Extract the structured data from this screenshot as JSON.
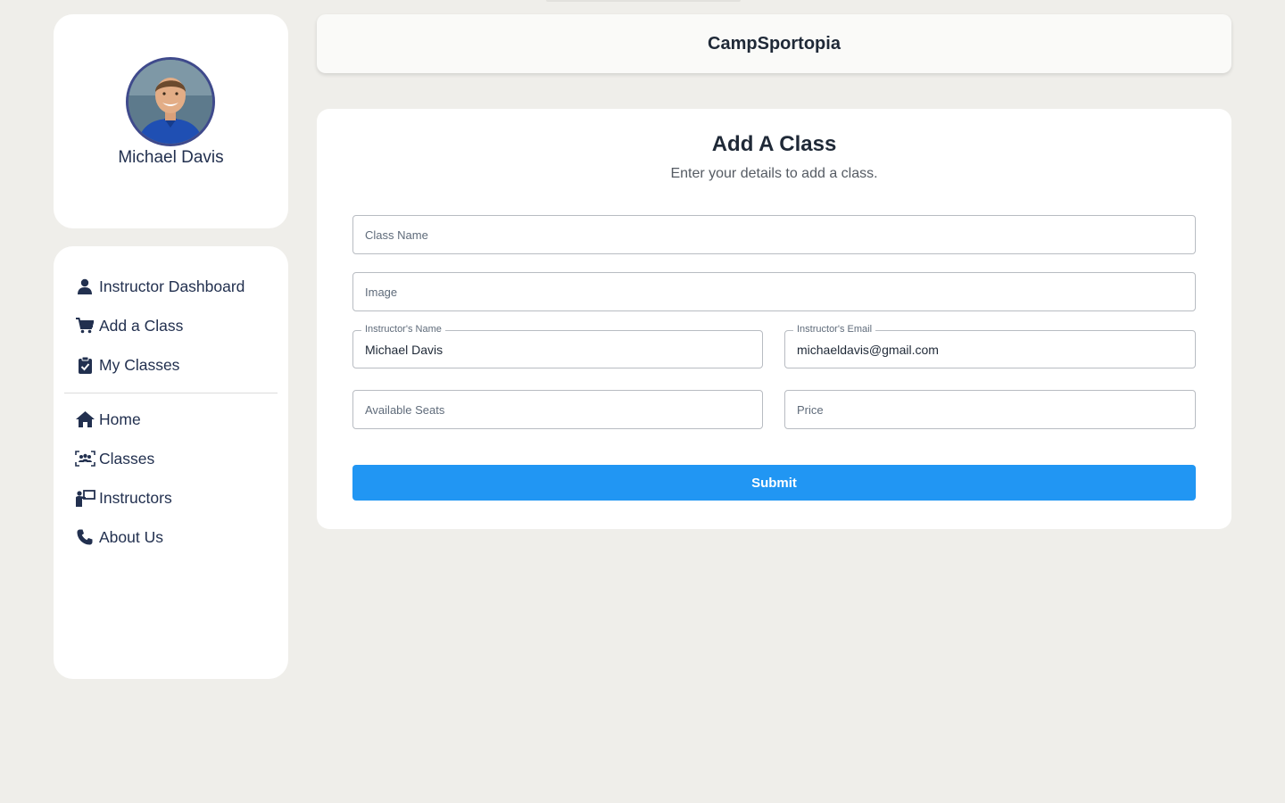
{
  "app": {
    "title": "CampSportopia"
  },
  "profile": {
    "name": "Michael Davis"
  },
  "sidebar": {
    "primary_items": [
      {
        "label": "Instructor Dashboard",
        "icon": "user-icon"
      },
      {
        "label": "Add a Class",
        "icon": "cart-icon"
      },
      {
        "label": "My Classes",
        "icon": "clipboard-check-icon"
      }
    ],
    "secondary_items": [
      {
        "label": "Home",
        "icon": "home-icon"
      },
      {
        "label": "Classes",
        "icon": "group-icon"
      },
      {
        "label": "Instructors",
        "icon": "instructor-icon"
      },
      {
        "label": "About Us",
        "icon": "phone-icon"
      }
    ]
  },
  "form": {
    "title": "Add A Class",
    "subtitle": "Enter your details to add a class.",
    "class_name": {
      "placeholder": "Class Name",
      "value": ""
    },
    "image": {
      "placeholder": "Image",
      "value": ""
    },
    "instructor_name": {
      "label": "Instructor's Name",
      "value": "Michael Davis"
    },
    "instructor_email": {
      "label": "Instructor's Email",
      "value": "michaeldavis@gmail.com"
    },
    "available_seats": {
      "placeholder": "Available Seats",
      "value": ""
    },
    "price": {
      "placeholder": "Price",
      "value": ""
    },
    "submit_label": "Submit"
  },
  "colors": {
    "page_bg": "#efeeea",
    "accent": "#2196f3",
    "avatar_ring": "#3f4a8c",
    "text_dark": "#22304f"
  }
}
